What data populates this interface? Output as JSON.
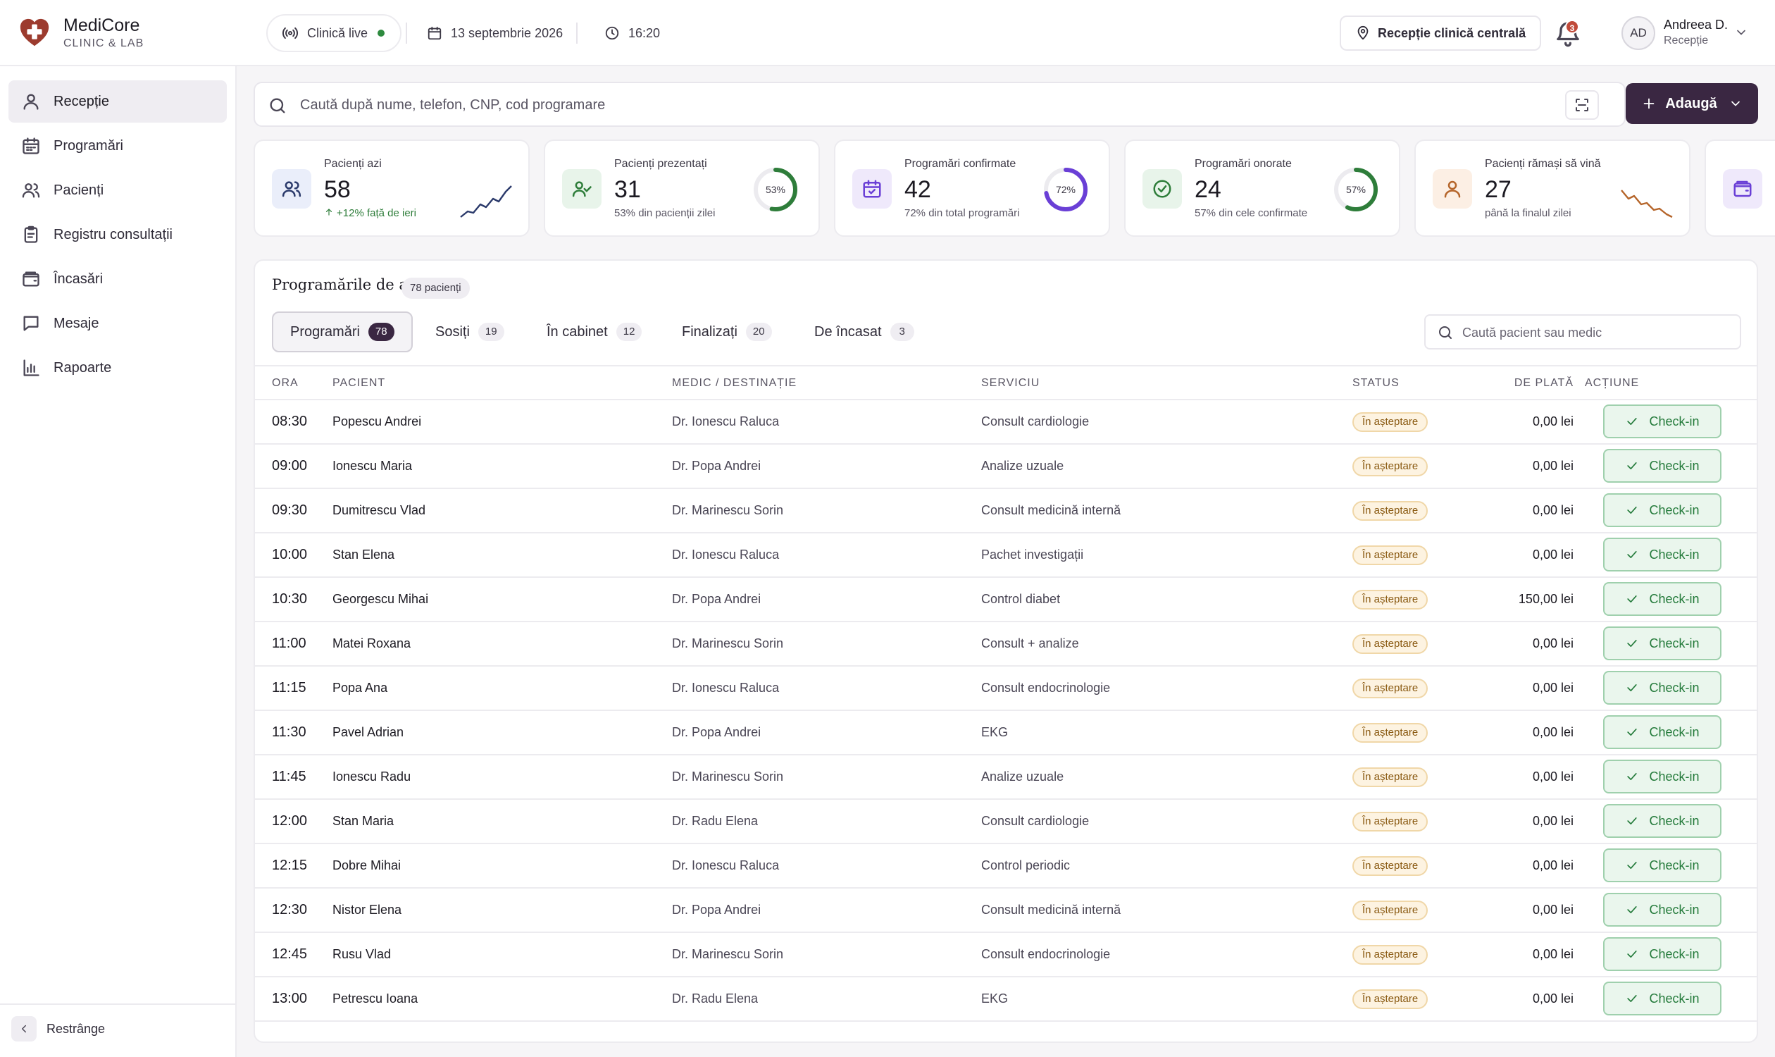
{
  "brand": {
    "name": "MediCore",
    "sub": "CLINIC & LAB"
  },
  "header": {
    "live_label": "Clinică live",
    "date": "13 septembrie 2026",
    "time": "16:20",
    "location": "Recepție clinică centrală",
    "notifications": "3",
    "user": {
      "initials": "AD",
      "name": "Andreea D.",
      "role": "Recepție"
    }
  },
  "sidebar": {
    "items": [
      {
        "label": "Recepție",
        "icon": "user-icon"
      },
      {
        "label": "Programări",
        "icon": "calendar-icon"
      },
      {
        "label": "Pacienți",
        "icon": "users-icon"
      },
      {
        "label": "Registru consultații",
        "icon": "clipboard-icon"
      },
      {
        "label": "Încasări",
        "icon": "wallet-icon"
      },
      {
        "label": "Mesaje",
        "icon": "message-icon"
      },
      {
        "label": "Rapoarte",
        "icon": "bar-chart-icon"
      }
    ],
    "collapse_label": "Restrânge"
  },
  "search": {
    "placeholder": "Caută după nume, telefon, CNP, cod programare"
  },
  "add_button": "Adaugă",
  "cards": [
    {
      "title": "Pacienți azi",
      "value": "58",
      "sub": "+12% față de ieri",
      "accent": "#2b3a6b"
    },
    {
      "title": "Pacienți prezentați",
      "value": "31",
      "sub": "53% din pacienții zilei",
      "percent": 53,
      "ring_label": "53%",
      "accent": "#2e7d3a"
    },
    {
      "title": "Programări confirmate",
      "value": "42",
      "sub": "72% din total programări",
      "percent": 72,
      "ring_label": "72%",
      "accent": "#6a3fd6"
    },
    {
      "title": "Programări onorate",
      "value": "24",
      "sub": "57% din cele confirmate",
      "percent": 57,
      "ring_label": "57%",
      "accent": "#2e7d3a"
    },
    {
      "title": "Pacienți rămași să vină",
      "value": "27",
      "sub": "până la finalul zilei",
      "accent": "#b5652a"
    }
  ],
  "panel": {
    "title": "Programările de azi",
    "count": "78 pacienți",
    "tabs": [
      {
        "label": "Programări",
        "count": "78"
      },
      {
        "label": "Sosiți",
        "count": "19"
      },
      {
        "label": "În cabinet",
        "count": "12"
      },
      {
        "label": "Finalizați",
        "count": "20"
      },
      {
        "label": "De încasat",
        "count": "3"
      }
    ],
    "search_placeholder": "Caută pacient sau medic",
    "columns": [
      "ORA",
      "PACIENT",
      "MEDIC / DESTINAȚIE",
      "SERVICIU",
      "STATUS",
      "DE PLATĂ",
      "ACȚIUNE"
    ],
    "action_label": "Check-in",
    "rows": [
      {
        "time": "08:30",
        "patient": "Popescu Andrei",
        "doctor": "Dr. Ionescu Raluca",
        "service": "Consult cardiologie",
        "status": "În așteptare",
        "amount": "0,00 lei"
      },
      {
        "time": "09:00",
        "patient": "Ionescu Maria",
        "doctor": "Dr. Popa Andrei",
        "service": "Analize uzuale",
        "status": "În așteptare",
        "amount": "0,00 lei"
      },
      {
        "time": "09:30",
        "patient": "Dumitrescu Vlad",
        "doctor": "Dr. Marinescu Sorin",
        "service": "Consult medicină internă",
        "status": "În așteptare",
        "amount": "0,00 lei"
      },
      {
        "time": "10:00",
        "patient": "Stan Elena",
        "doctor": "Dr. Ionescu Raluca",
        "service": "Pachet investigații",
        "status": "În așteptare",
        "amount": "0,00 lei"
      },
      {
        "time": "10:30",
        "patient": "Georgescu Mihai",
        "doctor": "Dr. Popa Andrei",
        "service": "Control diabet",
        "status": "În așteptare",
        "amount": "150,00 lei"
      },
      {
        "time": "11:00",
        "patient": "Matei Roxana",
        "doctor": "Dr. Marinescu Sorin",
        "service": "Consult + analize",
        "status": "În așteptare",
        "amount": "0,00 lei"
      },
      {
        "time": "11:15",
        "patient": "Popa Ana",
        "doctor": "Dr. Ionescu Raluca",
        "service": "Consult endocrinologie",
        "status": "În așteptare",
        "amount": "0,00 lei"
      },
      {
        "time": "11:30",
        "patient": "Pavel Adrian",
        "doctor": "Dr. Popa Andrei",
        "service": "EKG",
        "status": "În așteptare",
        "amount": "0,00 lei"
      },
      {
        "time": "11:45",
        "patient": "Ionescu Radu",
        "doctor": "Dr. Marinescu Sorin",
        "service": "Analize uzuale",
        "status": "În așteptare",
        "amount": "0,00 lei"
      },
      {
        "time": "12:00",
        "patient": "Stan Maria",
        "doctor": "Dr. Radu Elena",
        "service": "Consult cardiologie",
        "status": "În așteptare",
        "amount": "0,00 lei"
      },
      {
        "time": "12:15",
        "patient": "Dobre Mihai",
        "doctor": "Dr. Ionescu Raluca",
        "service": "Control periodic",
        "status": "În așteptare",
        "amount": "0,00 lei"
      },
      {
        "time": "12:30",
        "patient": "Nistor Elena",
        "doctor": "Dr. Popa Andrei",
        "service": "Consult medicină internă",
        "status": "În așteptare",
        "amount": "0,00 lei"
      },
      {
        "time": "12:45",
        "patient": "Rusu Vlad",
        "doctor": "Dr. Marinescu Sorin",
        "service": "Consult endocrinologie",
        "status": "În așteptare",
        "amount": "0,00 lei"
      },
      {
        "time": "13:00",
        "patient": "Petrescu Ioana",
        "doctor": "Dr. Radu Elena",
        "service": "EKG",
        "status": "În așteptare",
        "amount": "0,00 lei"
      }
    ]
  }
}
